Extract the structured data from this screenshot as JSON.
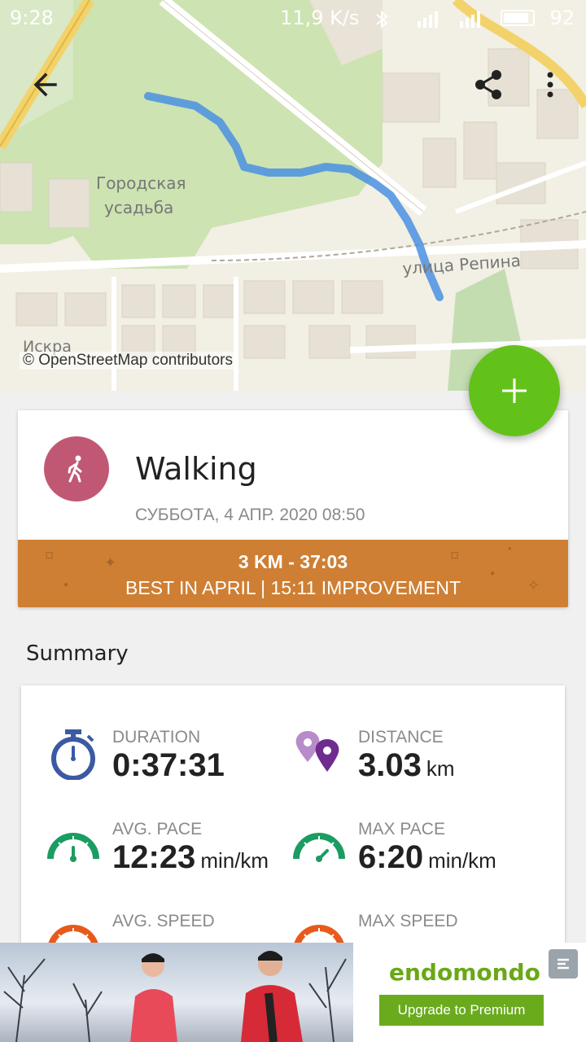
{
  "status_bar": {
    "time": "9:28",
    "net_speed": "11,9 K/s",
    "battery": "92"
  },
  "map": {
    "labels": {
      "district": "Городская\nусадьба",
      "district_line1": "Городская",
      "district_line2": "усадьба",
      "street": "улица Репина",
      "place": "Искра"
    },
    "credit": "© OpenStreetMap contributors",
    "route_color": "#4a90e2"
  },
  "toolbar": {
    "back_icon": "arrow-back-icon",
    "share_icon": "share-icon",
    "more_icon": "more-vertical-icon"
  },
  "fab": {
    "icon": "plus-icon",
    "color": "#63c21a"
  },
  "workout": {
    "sport": "Walking",
    "date": "СУББОТА, 4 АПР. 2020 08:50",
    "avatar_color": "#c05874",
    "record": {
      "line1": "3 KM  -  37:03",
      "line2": "BEST IN APRIL  |  15:11 IMPROVEMENT",
      "color": "#ce7f33"
    }
  },
  "summary": {
    "title": "Summary",
    "stats": [
      {
        "label": "DURATION",
        "value": "0:37:31",
        "unit": "",
        "icon": "stopwatch-icon"
      },
      {
        "label": "DISTANCE",
        "value": "3.03",
        "unit": "km",
        "icon": "map-pins-icon"
      },
      {
        "label": "AVG. PACE",
        "value": "12:23",
        "unit": "min/km",
        "icon": "gauge-icon"
      },
      {
        "label": "MAX PACE",
        "value": "6:20",
        "unit": "min/km",
        "icon": "gauge-icon"
      },
      {
        "label": "AVG. SPEED",
        "value": "",
        "unit": "",
        "icon": "speedometer-icon"
      },
      {
        "label": "MAX SPEED",
        "value": "",
        "unit": "",
        "icon": "speedometer-icon"
      }
    ]
  },
  "ad": {
    "brand": "endomondo",
    "cta": "Upgrade to Premium"
  }
}
